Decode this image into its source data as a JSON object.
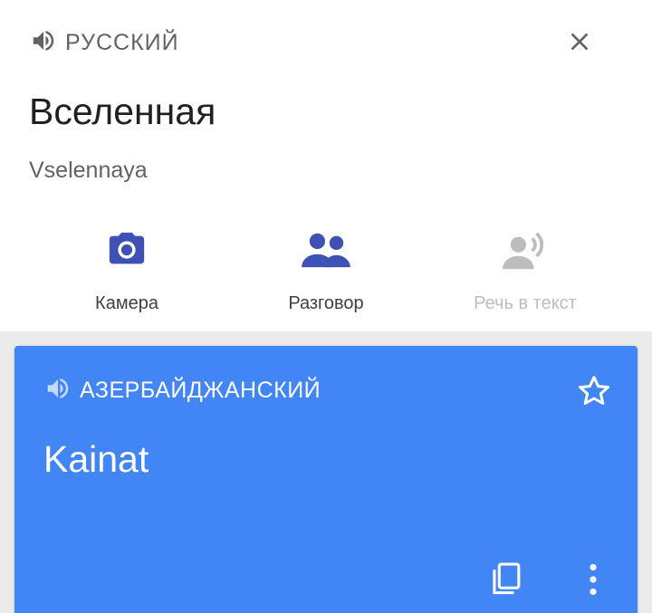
{
  "source": {
    "language": "РУССКИЙ",
    "text": "Вселенная",
    "transliteration": "Vselennaya"
  },
  "actions": [
    {
      "label": "Камера",
      "icon": "camera-icon",
      "enabled": true
    },
    {
      "label": "Разговор",
      "icon": "conversation-icon",
      "enabled": true
    },
    {
      "label": "Речь в текст",
      "icon": "speech-to-text-icon",
      "enabled": false
    }
  ],
  "translation": {
    "language": "АЗЕРБАЙДЖАНСКИЙ",
    "text": "Kainat"
  },
  "colors": {
    "accent": "#3f51b5",
    "card": "#4285f4"
  }
}
